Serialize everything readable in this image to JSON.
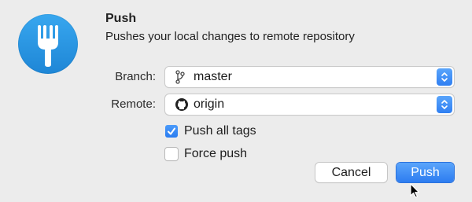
{
  "dialog": {
    "title": "Push",
    "subtitle": "Pushes your local changes to remote repository"
  },
  "icons": {
    "app_logo": "fork-icon",
    "branch": "git-branch-icon",
    "remote": "github-octocat-icon",
    "stepper": "chevron-up-down-icon",
    "checkmark": "checkmark-icon",
    "cursor": "arrow-cursor-icon"
  },
  "form": {
    "branch": {
      "label": "Branch:",
      "value": "master"
    },
    "remote": {
      "label": "Remote:",
      "value": "origin"
    },
    "push_all_tags": {
      "label": "Push all tags",
      "checked": true
    },
    "force_push": {
      "label": "Force push",
      "checked": false
    }
  },
  "buttons": {
    "cancel_label": "Cancel",
    "push_label": "Push"
  },
  "colors": {
    "accent": "#2f7ff2",
    "logo_blue": "#2a96e2",
    "background": "#ececec"
  }
}
